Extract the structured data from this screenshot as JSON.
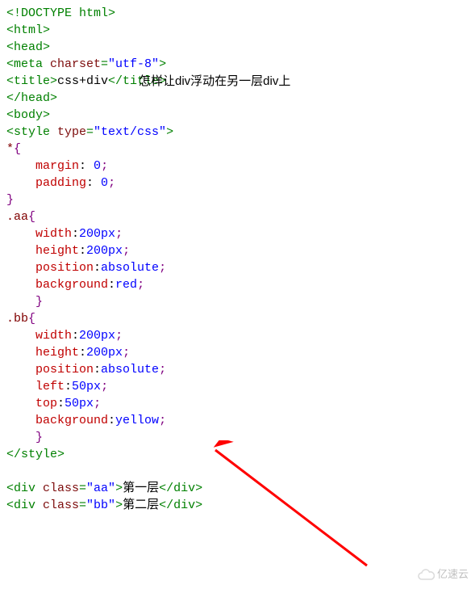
{
  "code": {
    "l1": {
      "a": "<!DOCTYPE html>"
    },
    "l2": {
      "a": "<html>"
    },
    "l3": {
      "a": "<head>"
    },
    "l4": {
      "a": "<meta ",
      "b": "charset",
      "c": "=",
      "d": "\"utf-8\"",
      "e": ">"
    },
    "l5": {
      "a": "<title>",
      "b": "css+div",
      "c": "</title>"
    },
    "l6": {
      "a": "</head>"
    },
    "l7": {
      "a": "<body>"
    },
    "l8": {
      "a": "<style ",
      "b": "type",
      "c": "=",
      "d": "\"text/css\"",
      "e": ">"
    },
    "l9": {
      "sel": "*",
      "br": "{"
    },
    "l10": {
      "p": "margin",
      "v": " 0"
    },
    "l11": {
      "p": "padding",
      "v": " 0"
    },
    "l12": {
      "br": "}"
    },
    "l13": {
      "sel": ".aa",
      "br": "{"
    },
    "l14": {
      "p": "width",
      "v": "200px"
    },
    "l15": {
      "p": "height",
      "v": "200px"
    },
    "l16": {
      "p": "position",
      "v": "absolute"
    },
    "l17": {
      "p": "background",
      "v": "red"
    },
    "l18": {
      "br": "}"
    },
    "l19": {
      "sel": ".bb",
      "br": "{"
    },
    "l20": {
      "p": "width",
      "v": "200px"
    },
    "l21": {
      "p": "height",
      "v": "200px"
    },
    "l22": {
      "p": "position",
      "v": "absolute"
    },
    "l23": {
      "p": "left",
      "v": "50px"
    },
    "l24": {
      "p": "top",
      "v": "50px"
    },
    "l25": {
      "p": "background",
      "v": "yellow"
    },
    "l26": {
      "br": "}"
    },
    "l27": {
      "a": "</style>"
    },
    "l28": {
      "a": "<div ",
      "b": "class",
      "c": "=",
      "d": "\"aa\"",
      "e": ">",
      "t": "第一层",
      "f": "</div>"
    },
    "l29": {
      "a": "<div ",
      "b": "class",
      "c": "=",
      "d": "\"bb\"",
      "e": ">",
      "t": "第二层",
      "f": "</div>"
    }
  },
  "overlay": "怎样让div浮动在另一层div上",
  "watermark": "亿速云"
}
